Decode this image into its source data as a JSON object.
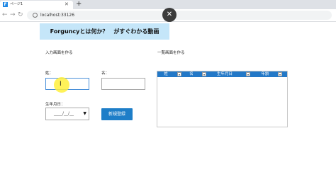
{
  "browser": {
    "tab_title": "ページ1",
    "url": "localhost:33126"
  },
  "page": {
    "banner": "Forguncyとは何か？　がすぐわかる動画",
    "input_section": "入力画面を作る",
    "list_section": "一覧画面を作る",
    "last_name_label": "姓：",
    "first_name_label": "名：",
    "birthdate_label": "生年月日：",
    "date_placeholder": "____/__/__",
    "register_button": "新規登録"
  },
  "grid": {
    "columns": [
      "姓",
      "名",
      "生年月日",
      "年齢"
    ]
  },
  "colors": {
    "banner_bg": "#c5e6f9",
    "grid_header": "#2378c7",
    "button": "#1e7ec8",
    "click_highlight": "#fff03c"
  }
}
